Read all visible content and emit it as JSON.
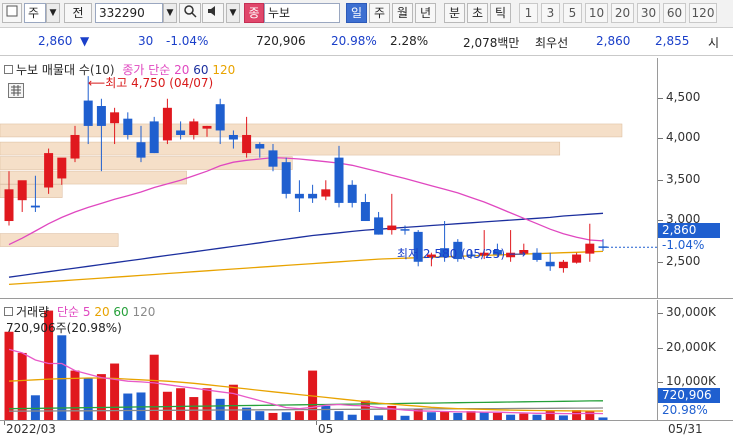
{
  "toolbar": {
    "market_label": "주",
    "code_label": "전",
    "stock_code": "332290",
    "stock_badge": "종",
    "stock_name": "누보",
    "period_buttons": [
      "일",
      "주",
      "월",
      "년",
      "분",
      "초",
      "틱"
    ],
    "selected_period": "일",
    "interval_buttons": [
      "1",
      "3",
      "5",
      "10",
      "20",
      "30",
      "60",
      "120"
    ]
  },
  "quote": {
    "price": "2,860",
    "change": "30",
    "change_pct": "-1.04%",
    "volume": "720,906",
    "volume_ratio": "20.98%",
    "turnover": "2.28%",
    "amount": "2,078백만",
    "best_ask_label": "최우선",
    "best_ask": "2,860",
    "best_bid": "2,855",
    "trailing_label": "시"
  },
  "price_panel": {
    "legend_name": "누보 매물대",
    "legend_param": "수(10)",
    "legend_ma_label": "종가 단순",
    "ma_periods": [
      "20",
      "60",
      "120"
    ],
    "high_note": "최고 4,750 (04/07)",
    "low_note": "최저 2,580 (05/25)",
    "axis_ticks": [
      "4,500",
      "4,000",
      "3,500",
      "3,000",
      "2,500"
    ],
    "current_price_tag": "2,860",
    "current_pct_tag": "-1.04%"
  },
  "volume_panel": {
    "legend_name": "거래량",
    "legend_ma_label": "단순 5",
    "ma_periods": [
      "20",
      "60",
      "120"
    ],
    "value_note": "720,906주(20.98%)",
    "axis_ticks": [
      "30,000K",
      "20,000K",
      "10,000K"
    ],
    "current_volume_tag": "720,906",
    "current_pct_tag": "20.98%"
  },
  "date_axis": [
    "2022/03",
    "05",
    "05/31"
  ],
  "colors": {
    "up": "#e0181e",
    "down": "#1f5fcf",
    "ma5": "#e85ac8",
    "ma20": "#e048c0",
    "ma60": "#1c2f9e",
    "ma120": "#e8a300",
    "vol_ma20": "#e8a300",
    "vol_ma60": "#26a03a",
    "vol_ma120": "#8a8a8a",
    "volume_profile": "#f5dfc8"
  },
  "chart_data": {
    "type": "candlestick",
    "candles": [
      {
        "o": 3150,
        "h": 3700,
        "l": 3100,
        "c": 3500
      },
      {
        "o": 3380,
        "h": 3500,
        "l": 3250,
        "c": 3600
      },
      {
        "o": 3320,
        "h": 3650,
        "l": 3250,
        "c": 3300
      },
      {
        "o": 3520,
        "h": 3950,
        "l": 3450,
        "c": 3900
      },
      {
        "o": 3620,
        "h": 3700,
        "l": 3550,
        "c": 3850
      },
      {
        "o": 3840,
        "h": 4200,
        "l": 3800,
        "c": 4100
      },
      {
        "o": 4480,
        "h": 4750,
        "l": 4000,
        "c": 4200
      },
      {
        "o": 4420,
        "h": 4500,
        "l": 3700,
        "c": 4200
      },
      {
        "o": 4230,
        "h": 4400,
        "l": 4000,
        "c": 4350
      },
      {
        "o": 4280,
        "h": 4350,
        "l": 4050,
        "c": 4100
      },
      {
        "o": 4020,
        "h": 4200,
        "l": 3800,
        "c": 3850
      },
      {
        "o": 4250,
        "h": 4300,
        "l": 3900,
        "c": 3900
      },
      {
        "o": 4040,
        "h": 4500,
        "l": 4000,
        "c": 4400
      },
      {
        "o": 4150,
        "h": 4250,
        "l": 4050,
        "c": 4100
      },
      {
        "o": 4100,
        "h": 4280,
        "l": 4050,
        "c": 4250
      },
      {
        "o": 4170,
        "h": 4200,
        "l": 4080,
        "c": 4200
      },
      {
        "o": 4440,
        "h": 4500,
        "l": 4000,
        "c": 4150
      },
      {
        "o": 4100,
        "h": 4150,
        "l": 3950,
        "c": 4050
      },
      {
        "o": 3900,
        "h": 4300,
        "l": 3850,
        "c": 4100
      },
      {
        "o": 4000,
        "h": 4020,
        "l": 3850,
        "c": 3950
      },
      {
        "o": 3930,
        "h": 4000,
        "l": 3700,
        "c": 3750
      },
      {
        "o": 3800,
        "h": 3850,
        "l": 3400,
        "c": 3450
      },
      {
        "o": 3450,
        "h": 3600,
        "l": 3250,
        "c": 3400
      },
      {
        "o": 3450,
        "h": 3550,
        "l": 3350,
        "c": 3400
      },
      {
        "o": 3420,
        "h": 3600,
        "l": 3380,
        "c": 3500
      },
      {
        "o": 3850,
        "h": 3980,
        "l": 3300,
        "c": 3350
      },
      {
        "o": 3550,
        "h": 3600,
        "l": 3300,
        "c": 3350
      },
      {
        "o": 3360,
        "h": 3450,
        "l": 3150,
        "c": 3150
      },
      {
        "o": 3190,
        "h": 3250,
        "l": 3000,
        "c": 3000
      },
      {
        "o": 3050,
        "h": 3450,
        "l": 3000,
        "c": 3100
      },
      {
        "o": 3060,
        "h": 3100,
        "l": 3000,
        "c": 3050
      },
      {
        "o": 3030,
        "h": 3050,
        "l": 2650,
        "c": 2700
      },
      {
        "o": 2750,
        "h": 2800,
        "l": 2650,
        "c": 2780
      },
      {
        "o": 2850,
        "h": 3150,
        "l": 2700,
        "c": 2750
      },
      {
        "o": 2920,
        "h": 2950,
        "l": 2700,
        "c": 2730
      },
      {
        "o": 2780,
        "h": 2830,
        "l": 2730,
        "c": 2760
      },
      {
        "o": 2770,
        "h": 3050,
        "l": 2730,
        "c": 2800
      },
      {
        "o": 2830,
        "h": 2900,
        "l": 2760,
        "c": 2780
      },
      {
        "o": 2750,
        "h": 3050,
        "l": 2700,
        "c": 2800
      },
      {
        "o": 2790,
        "h": 2900,
        "l": 2780,
        "c": 2830
      },
      {
        "o": 2800,
        "h": 2850,
        "l": 2700,
        "c": 2720
      },
      {
        "o": 2700,
        "h": 2800,
        "l": 2600,
        "c": 2650
      },
      {
        "o": 2630,
        "h": 2720,
        "l": 2580,
        "c": 2700
      },
      {
        "o": 2690,
        "h": 2800,
        "l": 2680,
        "c": 2780
      },
      {
        "o": 2790,
        "h": 3120,
        "l": 2700,
        "c": 2900
      },
      {
        "o": 2870,
        "h": 2950,
        "l": 2820,
        "c": 2860
      }
    ],
    "ma20": [
      2890,
      2960,
      3040,
      3120,
      3190,
      3250,
      3300,
      3345,
      3390,
      3430,
      3470,
      3520,
      3560,
      3600,
      3650,
      3700,
      3760,
      3800,
      3820,
      3835,
      3850,
      3845,
      3835,
      3820,
      3805,
      3790,
      3765,
      3730,
      3695,
      3655,
      3620,
      3580,
      3540,
      3500,
      3460,
      3410,
      3360,
      3300,
      3240,
      3180,
      3120,
      3060,
      3010,
      2970,
      2940,
      2930
    ],
    "ma60": [
      2530,
      2550,
      2570,
      2590,
      2610,
      2630,
      2650,
      2670,
      2690,
      2710,
      2730,
      2750,
      2770,
      2790,
      2810,
      2830,
      2850,
      2870,
      2890,
      2910,
      2930,
      2950,
      2970,
      2990,
      3005,
      3020,
      3035,
      3050,
      3060,
      3070,
      3080,
      3090,
      3100,
      3110,
      3120,
      3130,
      3140,
      3150,
      3160,
      3170,
      3180,
      3190,
      3205,
      3215,
      3225,
      3235
    ],
    "ma120": [
      2450,
      2460,
      2470,
      2480,
      2490,
      2500,
      2510,
      2520,
      2530,
      2540,
      2550,
      2560,
      2570,
      2580,
      2590,
      2600,
      2610,
      2620,
      2630,
      2640,
      2650,
      2660,
      2670,
      2680,
      2690,
      2700,
      2710,
      2720,
      2730,
      2735,
      2740,
      2745,
      2750,
      2755,
      2760,
      2765,
      2770,
      2775,
      2780,
      2785,
      2790,
      2795,
      2800,
      2805,
      2810,
      2815
    ],
    "volume_profile": [
      {
        "price": 4150,
        "share": 1.0
      },
      {
        "price": 3950,
        "share": 0.9
      },
      {
        "price": 3790,
        "share": 0.47
      },
      {
        "price": 3630,
        "share": 0.3
      },
      {
        "price": 3480,
        "share": 0.1
      },
      {
        "price": 2940,
        "share": 0.19
      }
    ],
    "volume": [
      {
        "v": 25000,
        "up": true
      },
      {
        "v": 19000,
        "up": true
      },
      {
        "v": 7000,
        "up": false
      },
      {
        "v": 31000,
        "up": true
      },
      {
        "v": 24000,
        "up": false
      },
      {
        "v": 14000,
        "up": true
      },
      {
        "v": 12000,
        "up": false
      },
      {
        "v": 13000,
        "up": true
      },
      {
        "v": 16000,
        "up": true
      },
      {
        "v": 7500,
        "up": false
      },
      {
        "v": 7800,
        "up": false
      },
      {
        "v": 18500,
        "up": true
      },
      {
        "v": 8000,
        "up": true
      },
      {
        "v": 9000,
        "up": true
      },
      {
        "v": 6500,
        "up": true
      },
      {
        "v": 9000,
        "up": true
      },
      {
        "v": 6000,
        "up": false
      },
      {
        "v": 10000,
        "up": true
      },
      {
        "v": 3500,
        "up": false
      },
      {
        "v": 2500,
        "up": false
      },
      {
        "v": 2000,
        "up": true
      },
      {
        "v": 2200,
        "up": false
      },
      {
        "v": 2500,
        "up": true
      },
      {
        "v": 14000,
        "up": true
      },
      {
        "v": 4000,
        "up": false
      },
      {
        "v": 2500,
        "up": false
      },
      {
        "v": 1500,
        "up": false
      },
      {
        "v": 5500,
        "up": true
      },
      {
        "v": 1300,
        "up": false
      },
      {
        "v": 4000,
        "up": true
      },
      {
        "v": 1200,
        "up": false
      },
      {
        "v": 3000,
        "up": true
      },
      {
        "v": 2200,
        "up": false
      },
      {
        "v": 2400,
        "up": true
      },
      {
        "v": 2000,
        "up": false
      },
      {
        "v": 2500,
        "up": true
      },
      {
        "v": 2300,
        "up": false
      },
      {
        "v": 2000,
        "up": true
      },
      {
        "v": 1500,
        "up": false
      },
      {
        "v": 1800,
        "up": true
      },
      {
        "v": 1500,
        "up": false
      },
      {
        "v": 2500,
        "up": true
      },
      {
        "v": 1300,
        "up": false
      },
      {
        "v": 2800,
        "up": true
      },
      {
        "v": 2400,
        "up": true
      },
      {
        "v": 721,
        "up": false
      }
    ],
    "vol_ma5": [
      20000,
      19000,
      17000,
      16000,
      16000,
      14000,
      13000,
      12000,
      11500,
      11000,
      10800,
      10500,
      10000,
      9500,
      9000,
      8500,
      8000,
      7500,
      6500,
      5500,
      4500,
      3500,
      3200,
      3600,
      4200,
      4400,
      4100,
      4000,
      3500,
      3200,
      2800,
      2600,
      2500,
      2400,
      2300,
      2300,
      2200,
      2200,
      2100,
      2000,
      1900,
      1900,
      1800,
      1800,
      1900,
      1800
    ],
    "vol_ma20": [
      11000,
      11200,
      11400,
      11600,
      11700,
      11800,
      11900,
      11900,
      11800,
      11600,
      11400,
      11200,
      11000,
      10700,
      10400,
      10000,
      9600,
      9200,
      8800,
      8400,
      8000,
      7600,
      7200,
      6800,
      6400,
      6000,
      5600,
      5200,
      4800,
      4500,
      4200,
      3900,
      3600,
      3400,
      3200,
      3100,
      3000,
      2900,
      2800,
      2750,
      2700,
      2650,
      2600,
      2580,
      2560,
      2550
    ],
    "vol_ma60": [
      3200,
      3250,
      3300,
      3350,
      3400,
      3450,
      3500,
      3550,
      3600,
      3650,
      3700,
      3750,
      3800,
      3850,
      3900,
      3950,
      4000,
      4050,
      4100,
      4150,
      4200,
      4250,
      4300,
      4350,
      4400,
      4450,
      4500,
      4550,
      4600,
      4650,
      4700,
      4750,
      4800,
      4850,
      4900,
      4950,
      5000,
      5050,
      5100,
      5150,
      5200,
      5250,
      5300,
      5350,
      5400,
      5450
    ],
    "vol_ma120": [
      2500,
      2520,
      2540,
      2560,
      2580,
      2600,
      2620,
      2640,
      2660,
      2680,
      2700,
      2720,
      2740,
      2760,
      2780,
      2800,
      2820,
      2840,
      2860,
      2880,
      2900,
      2920,
      2940,
      2960,
      2980,
      3000,
      3020,
      3040,
      3060,
      3080,
      3100,
      3120,
      3140,
      3160,
      3180,
      3200,
      3220,
      3240,
      3260,
      3280,
      3300,
      3320,
      3340,
      3360,
      3380,
      3400
    ],
    "price_ylim": [
      2300,
      4950
    ],
    "volume_ylim": [
      0,
      34000
    ],
    "volume_unit": "K"
  }
}
